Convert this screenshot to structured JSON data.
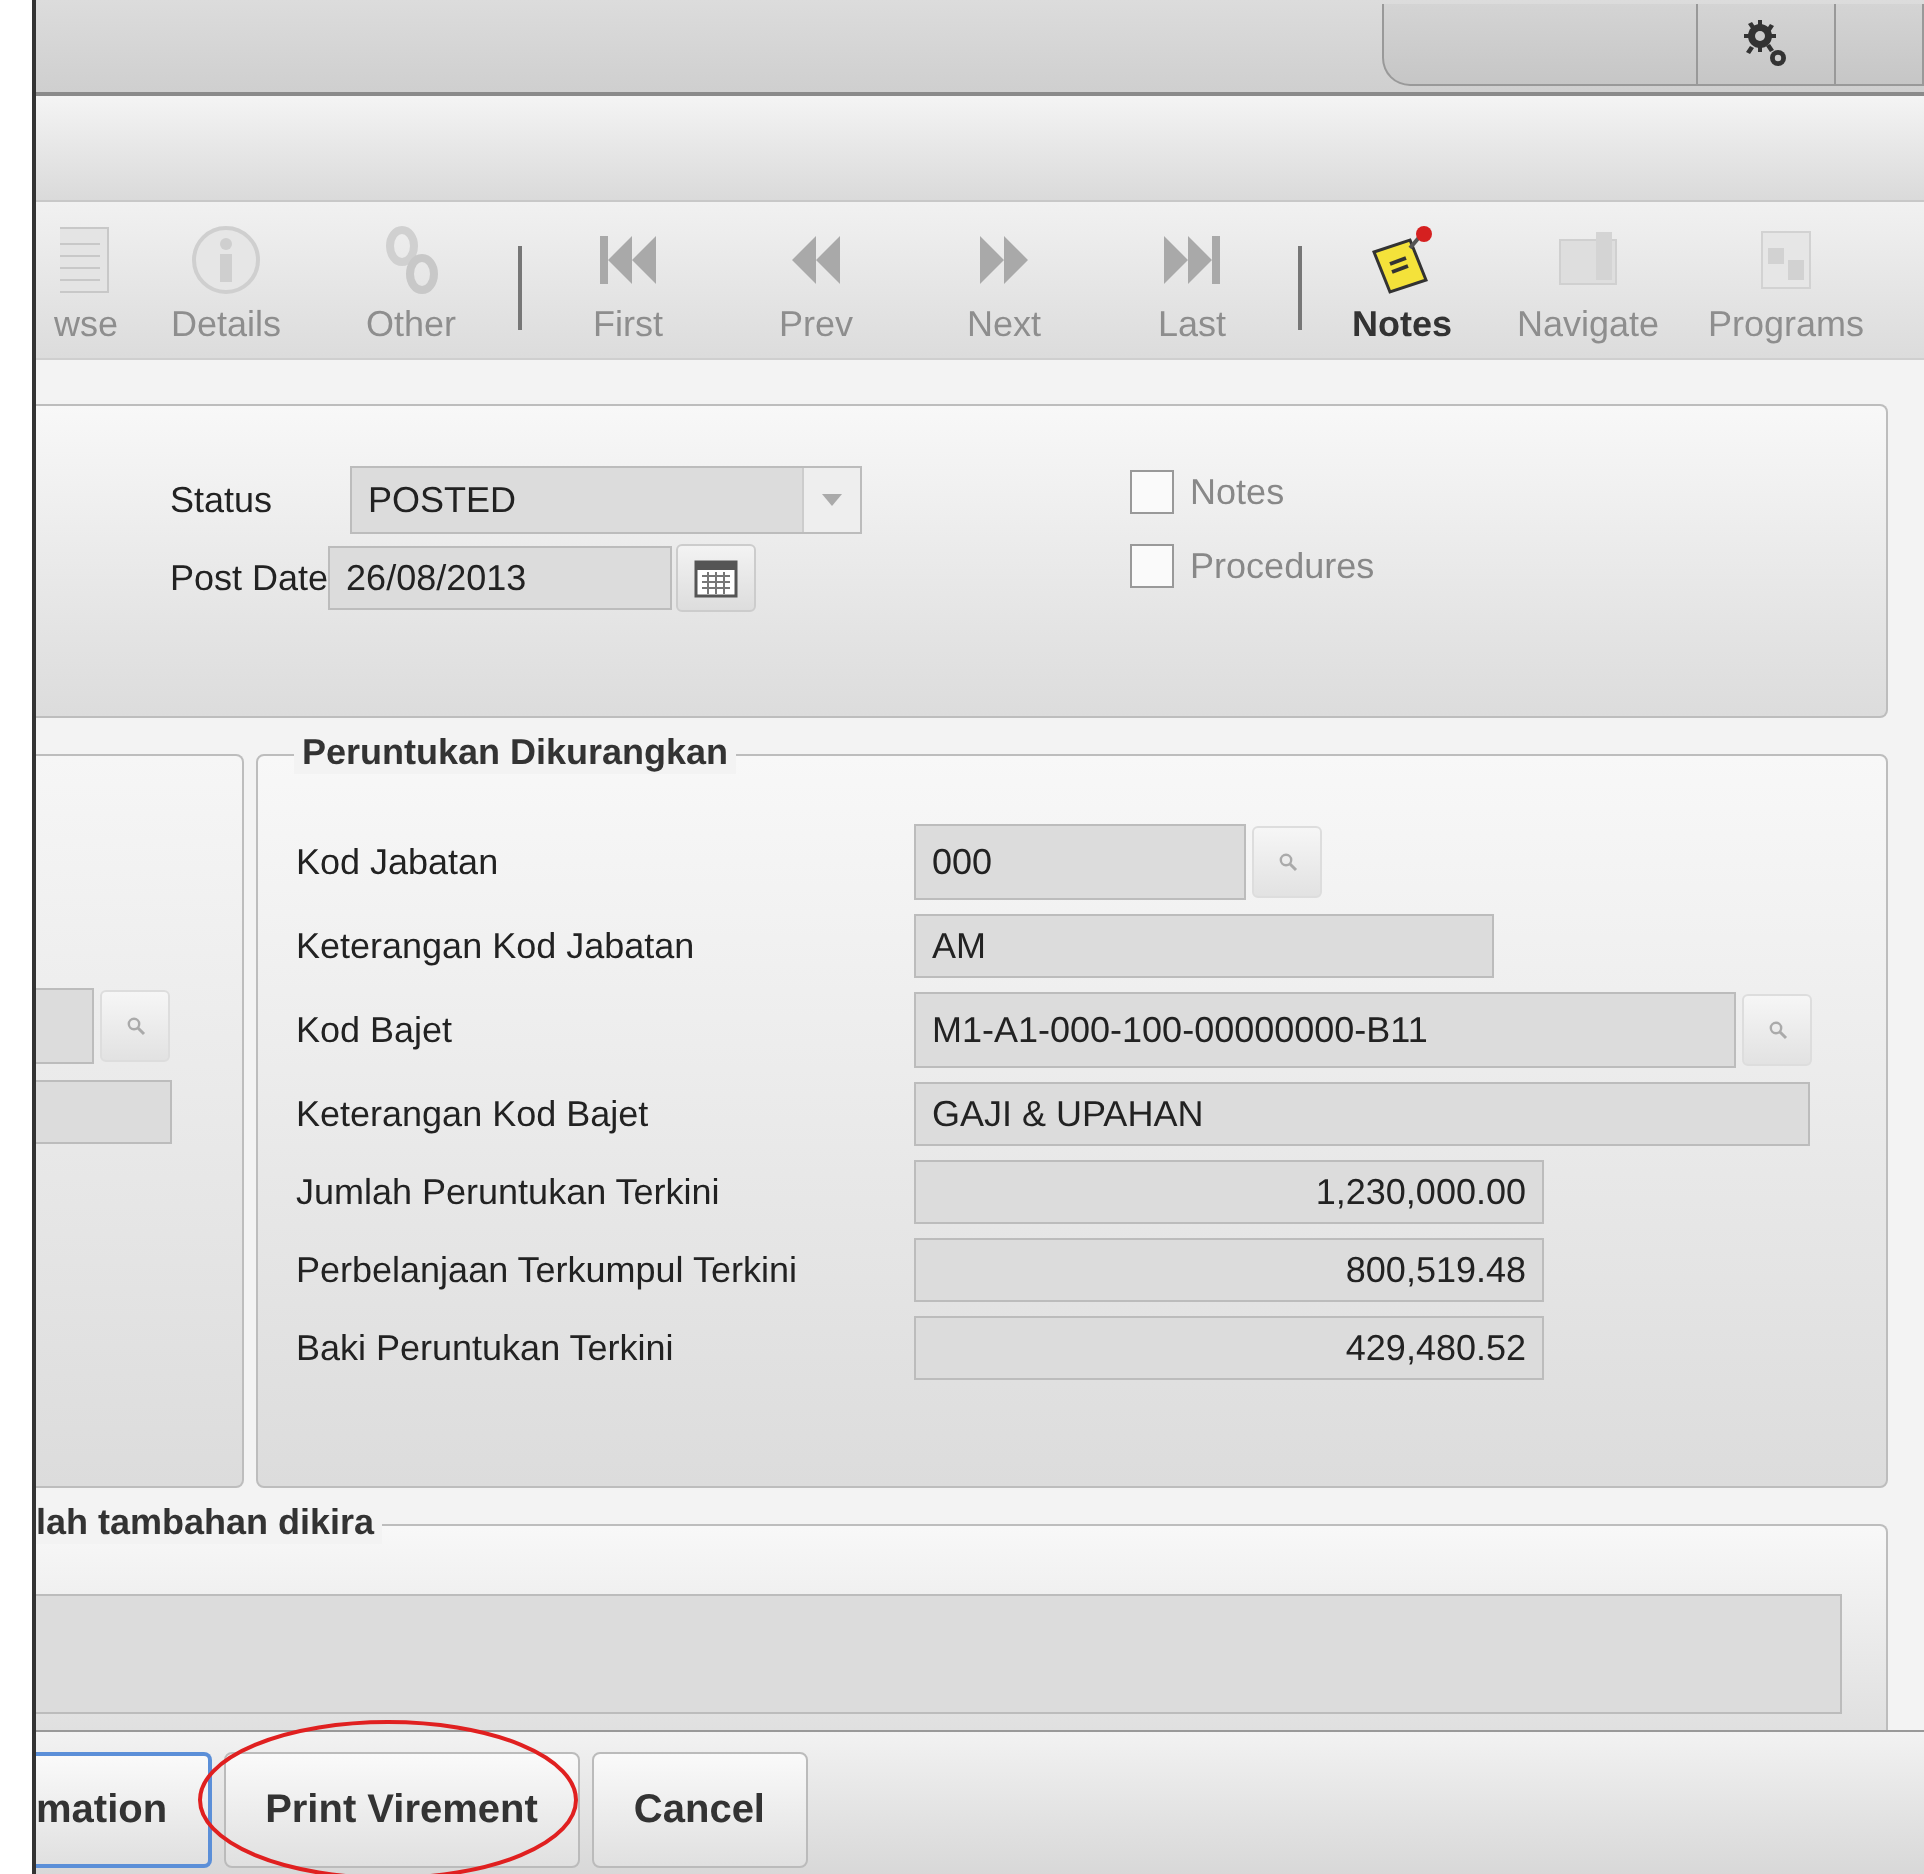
{
  "toolbar": [
    {
      "kind": "button",
      "label": "wse",
      "disabled": true
    },
    {
      "kind": "button",
      "label": "Details",
      "disabled": true
    },
    {
      "kind": "button",
      "label": "Other",
      "disabled": true
    },
    {
      "kind": "separator"
    },
    {
      "kind": "button",
      "label": "First",
      "disabled": true
    },
    {
      "kind": "button",
      "label": "Prev",
      "disabled": true
    },
    {
      "kind": "button",
      "label": "Next",
      "disabled": true
    },
    {
      "kind": "button",
      "label": "Last",
      "disabled": true
    },
    {
      "kind": "separator"
    },
    {
      "kind": "button",
      "label": "Notes",
      "disabled": false
    },
    {
      "kind": "button",
      "label": "Navigate",
      "disabled": true
    },
    {
      "kind": "button",
      "label": "Programs",
      "disabled": true
    }
  ],
  "header": {
    "status": {
      "label": "Status",
      "value": "POSTED"
    },
    "post_date": {
      "label": "Post Date",
      "value": "26/08/2013"
    },
    "checkboxes": [
      {
        "label": "Notes",
        "checked": false
      },
      {
        "label": "Procedures",
        "checked": false
      }
    ]
  },
  "left_panel": {
    "fields": [
      {
        "kind": "lookup"
      },
      {
        "kind": "text"
      }
    ]
  },
  "peruntukan_dikurangkan": {
    "legend": "Peruntukan Dikurangkan",
    "fields": [
      {
        "kind": "lookup",
        "label": "Kod Jabatan",
        "value": "000"
      },
      {
        "kind": "text",
        "label": "Keterangan Kod Jabatan",
        "value": "AM"
      },
      {
        "kind": "lookup_wide",
        "label": "Kod Bajet",
        "value": "M1-A1-000-100-00000000-B11"
      },
      {
        "kind": "wide",
        "label": "Keterangan Kod Bajet",
        "value": "GAJI & UPAHAN"
      },
      {
        "kind": "amount",
        "label": "Jumlah Peruntukan Terkini",
        "value": "1,230,000.00"
      },
      {
        "kind": "amount",
        "label": "Perbelanjaan Terkumpul Terkini",
        "value": "800,519.48"
      },
      {
        "kind": "amount",
        "label": "Baki Peruntukan Terkini",
        "value": "429,480.52"
      }
    ]
  },
  "bottom_fieldset": {
    "legend": "lah tambahan dikira"
  },
  "buttons": [
    {
      "label": "mation",
      "focused": true
    },
    {
      "label": "Print Virement",
      "focused": false
    },
    {
      "label": "Cancel",
      "focused": false
    }
  ],
  "annotation": {
    "kind": "ellipse",
    "color": "#e02020"
  }
}
